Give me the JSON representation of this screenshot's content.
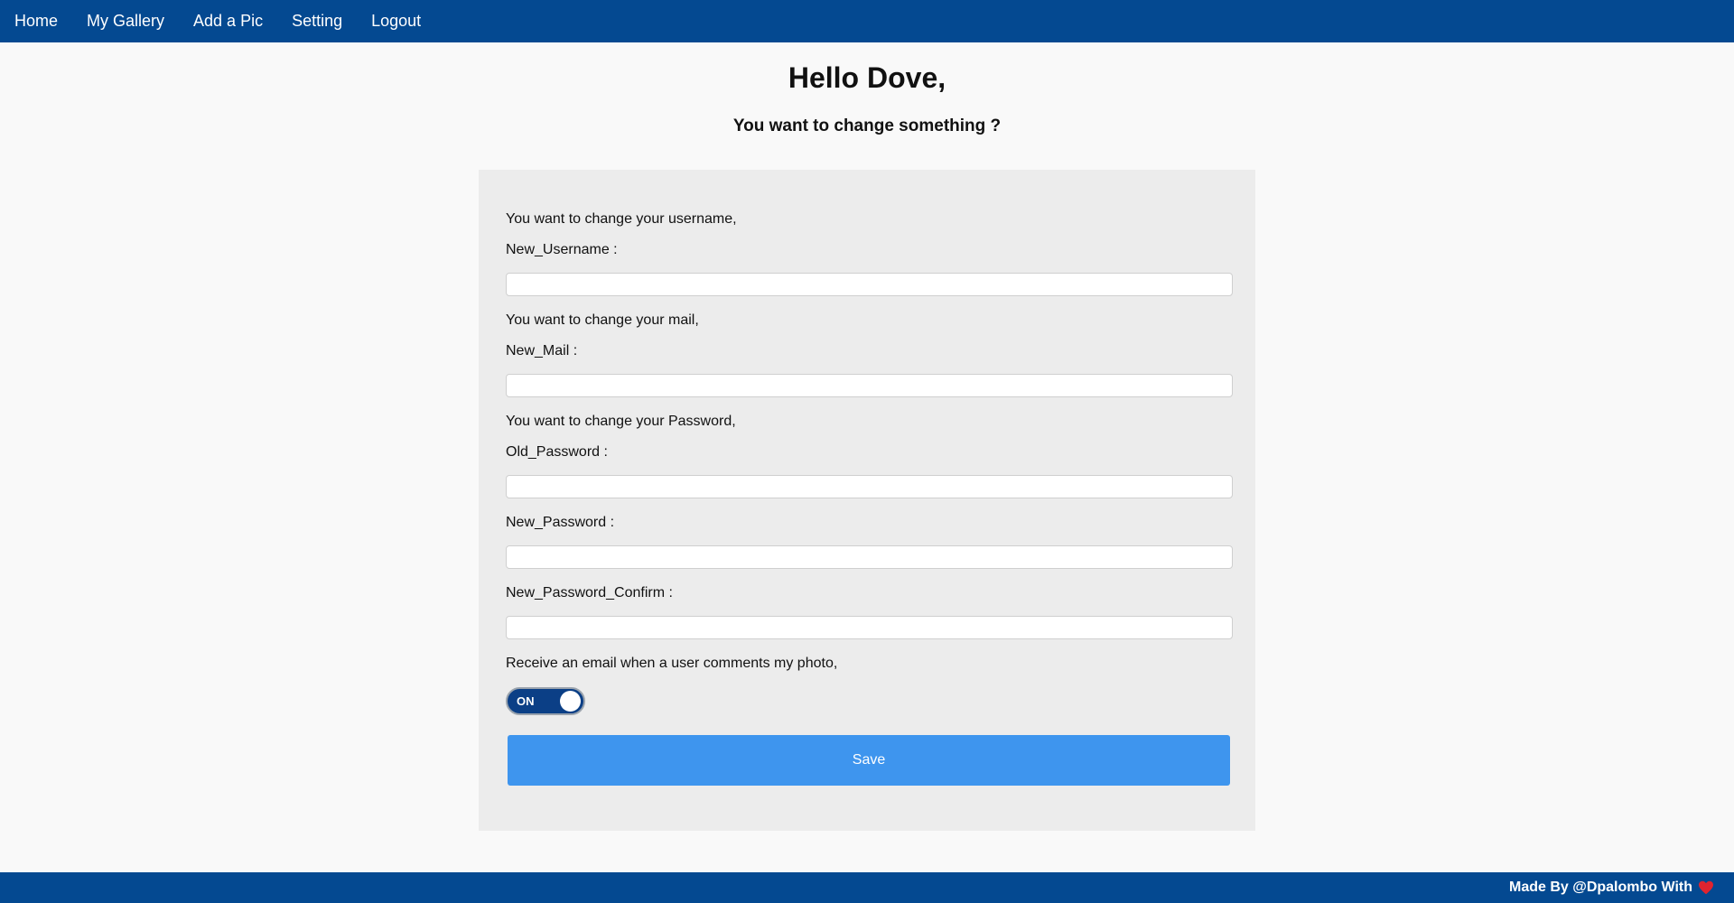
{
  "nav": {
    "items": [
      "Home",
      "My Gallery",
      "Add a Pic",
      "Setting",
      "Logout"
    ]
  },
  "header": {
    "greeting": "Hello Dove,",
    "subtitle": "You want to change something ?"
  },
  "form": {
    "username_intro": "You want to change your username,",
    "username_label": "New_Username :",
    "username_value": "",
    "mail_intro": "You want to change your mail,",
    "mail_label": "New_Mail :",
    "mail_value": "",
    "password_intro": "You want to change your Password,",
    "old_password_label": "Old_Password :",
    "old_password_value": "",
    "new_password_label": "New_Password :",
    "new_password_value": "",
    "confirm_password_label": "New_Password_Confirm :",
    "confirm_password_value": "",
    "notify_label": "Receive an email when a user comments my photo,",
    "toggle_state": "ON",
    "save_label": "Save"
  },
  "footer": {
    "credit": "Made By @Dpalombo With",
    "heart_icon": "heart-icon"
  },
  "colors": {
    "nav_bg": "#044991",
    "card_bg": "#ececec",
    "save_button": "#3e95ee",
    "toggle_on": "#0b3f86",
    "heart": "#e0242f"
  }
}
